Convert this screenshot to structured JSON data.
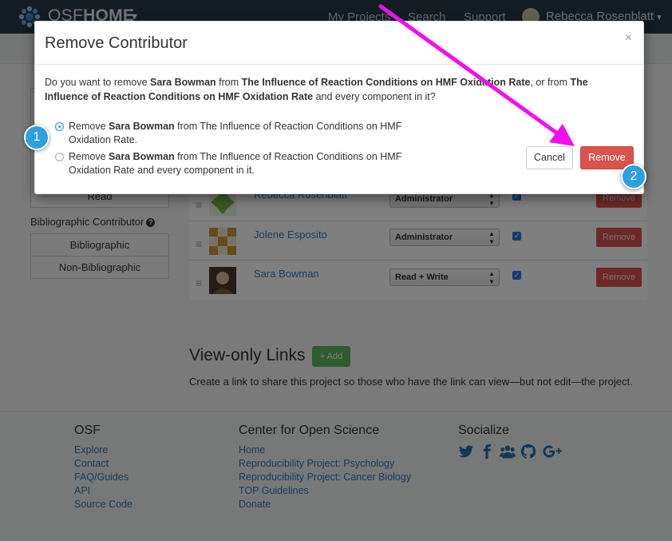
{
  "navbar": {
    "brand_light": "OSF",
    "brand_bold": "HOME",
    "brand_caret": "▾",
    "links": [
      "My Projects",
      "Search",
      "Support"
    ],
    "user_name": "Rebecca Rosenblatt",
    "user_caret": "▾"
  },
  "sidebar": {
    "permission_read": "Read",
    "bibliographic_header": "Bibliographic Contributor",
    "help_icon_glyph": "?",
    "filters": [
      "Bibliographic",
      "Non-Bibliographic"
    ]
  },
  "contributors": [
    {
      "name": "Rebecca Rosenblatt",
      "permission": "Administrator",
      "remove_label": "Remove",
      "avatar_color": "#7bb34a"
    },
    {
      "name": "Jolene Esposito",
      "permission": "Administrator",
      "remove_label": "Remove",
      "avatar_color": "#c99a3b"
    },
    {
      "name": "Sara Bowman",
      "permission": "Read + Write",
      "remove_label": "Remove",
      "avatar_color": "#7a5a3a"
    }
  ],
  "view_only": {
    "title": "View-only Links",
    "add_label": "+ Add",
    "description": "Create a link to share this project so those who have the link can view—but not edit—the project."
  },
  "footer": {
    "osf": {
      "title": "OSF",
      "links": [
        "Explore",
        "Contact",
        "FAQ/Guides",
        "API",
        "Source Code"
      ]
    },
    "cos": {
      "title": "Center for Open Science",
      "links": [
        "Home",
        "Reproducibility Project: Psychology",
        "Reproducibility Project: Cancer Biology",
        "TOP Guidelines",
        "Donate"
      ]
    },
    "social": {
      "title": "Socialize",
      "icons": [
        "twitter-icon",
        "facebook-icon",
        "group-icon",
        "github-icon",
        "google-plus-icon"
      ]
    }
  },
  "modal": {
    "title": "Remove Contributor",
    "close": "×",
    "question_p1": "Do you want to remove ",
    "person": "Sara Bowman",
    "question_p2": " from ",
    "project": "The Influence of Reaction Conditions on HMF Oxidation Rate",
    "question_p3": ", or from ",
    "question_p4": " and every component in it?",
    "option1_prefix": "Remove ",
    "option1_suffix": " from The Influence of Reaction Conditions on HMF Oxidation Rate.",
    "option2_prefix": "Remove ",
    "option2_suffix": " from The Influence of Reaction Conditions on HMF Oxidation Rate and every component in it.",
    "selected_option": 1,
    "cancel_label": "Cancel",
    "remove_label": "Remove"
  },
  "callouts": [
    "1",
    "2"
  ],
  "colors": {
    "navbar": "#263947",
    "link": "#337ab7",
    "danger": "#d9534f",
    "success": "#5cb85c",
    "callout": "#2ea0e0",
    "annotation_arrow": "#ee11ee"
  }
}
